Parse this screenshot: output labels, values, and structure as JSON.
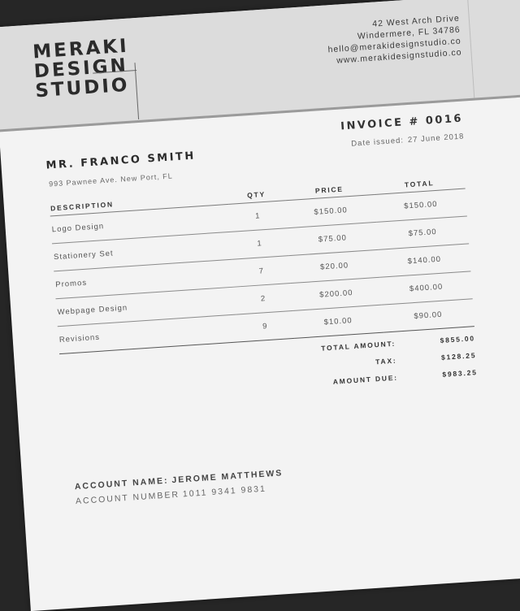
{
  "company": {
    "name_lines": [
      "MERAKI",
      "DESIGN",
      "STUDIO"
    ],
    "address_line1": "42 West Arch Drive",
    "address_line2": "Windermere, FL 34786",
    "email": "hello@merakidesignstudio.co",
    "website": "www.merakidesignstudio.co"
  },
  "client": {
    "name": "MR. FRANCO SMITH",
    "address": "993 Pawnee Ave. New Port, FL"
  },
  "invoice": {
    "title": "INVOICE # 0016",
    "date_label": "Date issued:",
    "date": "27 June 2018"
  },
  "table": {
    "headers": {
      "description": "DESCRIPTION",
      "qty": "QTY",
      "price": "PRICE",
      "total": "TOTAL"
    },
    "rows": [
      {
        "description": "Logo Design",
        "qty": "1",
        "price": "$150.00",
        "total": "$150.00"
      },
      {
        "description": "Stationery Set",
        "qty": "1",
        "price": "$75.00",
        "total": "$75.00"
      },
      {
        "description": "Promos",
        "qty": "7",
        "price": "$20.00",
        "total": "$140.00"
      },
      {
        "description": "Webpage Design",
        "qty": "2",
        "price": "$200.00",
        "total": "$400.00"
      },
      {
        "description": "Revisions",
        "qty": "9",
        "price": "$10.00",
        "total": "$90.00"
      }
    ]
  },
  "totals": {
    "total_amount_label": "TOTAL AMOUNT:",
    "total_amount": "$855.00",
    "tax_label": "TAX:",
    "tax": "$128.25",
    "amount_due_label": "AMOUNT DUE:",
    "amount_due": "$983.25"
  },
  "account": {
    "name_label": "ACCOUNT NAME:",
    "name": "JEROME MATTHEWS",
    "number_label": "ACCOUNT NUMBER",
    "number": "1011 9341 9831"
  }
}
